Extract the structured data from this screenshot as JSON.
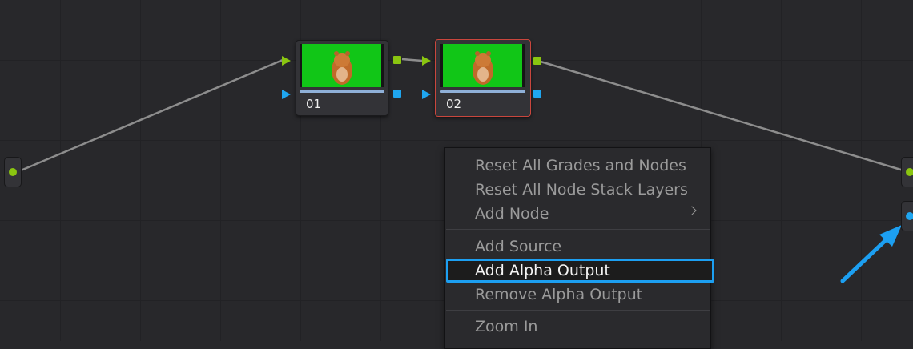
{
  "nodes": [
    {
      "label": "01",
      "selected": false
    },
    {
      "label": "02",
      "selected": true
    }
  ],
  "context_menu": {
    "items": [
      {
        "label": "Reset All Grades and Nodes"
      },
      {
        "label": "Reset All Node Stack Layers"
      },
      {
        "label": "Add Node",
        "has_submenu": true
      },
      {
        "label": "Add Source"
      },
      {
        "label": "Add Alpha Output",
        "highlighted": true
      },
      {
        "label": "Remove Alpha Output"
      },
      {
        "label": "Zoom In"
      }
    ]
  },
  "colors": {
    "background": "#28282b",
    "rgb_port": "#8ac510",
    "alpha_port": "#1fa6f0",
    "selected_border": "#c9463d",
    "highlight_outline": "#1c9ff1",
    "annotation_arrow": "#1c9ff1"
  },
  "icons": {
    "thumbnail_subject": "hamster-on-green-screen",
    "annotation": "pointer-arrow-icon"
  }
}
